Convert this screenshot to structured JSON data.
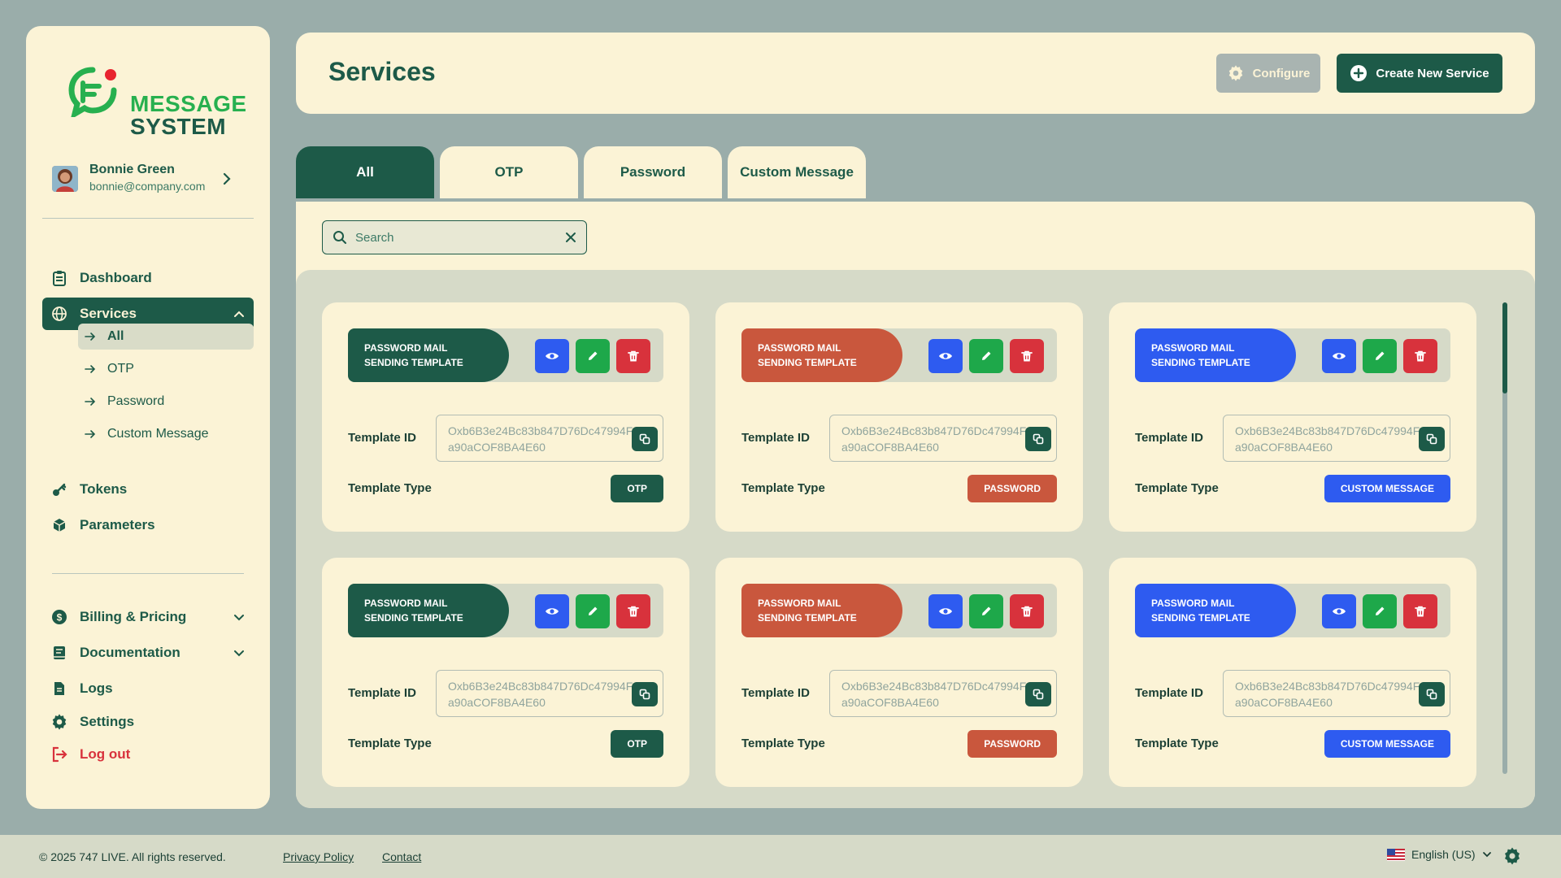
{
  "colors": {
    "primary": "#1d5a48",
    "otp": "#1d5a48",
    "password": "#c9573d",
    "custom": "#2e5bf0",
    "view": "#2e5bf0",
    "edit": "#1ea84a",
    "delete": "#d8323c",
    "cream": "#fbf3d6"
  },
  "brand": {
    "line1": "MESSAGE",
    "line2": "SYSTEM"
  },
  "user": {
    "name": "Bonnie Green",
    "email": "bonnie@company.com"
  },
  "nav": {
    "dashboard": "Dashboard",
    "services": "Services",
    "sub": {
      "all": "All",
      "otp": "OTP",
      "password": "Password",
      "custom": "Custom Message"
    },
    "tokens": "Tokens",
    "parameters": "Parameters",
    "billing": "Billing & Pricing",
    "documentation": "Documentation",
    "logs": "Logs",
    "settings": "Settings",
    "logout": "Log out"
  },
  "header": {
    "title": "Services",
    "configure": "Configure",
    "create": "Create New Service"
  },
  "tabs": [
    "All",
    "OTP",
    "Password",
    "Custom Message"
  ],
  "search": {
    "placeholder": "Search"
  },
  "cards": [
    {
      "title_line1": "PASSWORD MAIL",
      "title_line2": "SENDING TEMPLATE",
      "id_label": "Template ID",
      "template_id": "Oxb6B3e24Bc83b847D76Dc47994Fa90aCOF8BA4E60",
      "type_label": "Template Type",
      "type": "OTP"
    },
    {
      "title_line1": "PASSWORD MAIL",
      "title_line2": "SENDING TEMPLATE",
      "id_label": "Template ID",
      "template_id": "Oxb6B3e24Bc83b847D76Dc47994Fa90aCOF8BA4E60",
      "type_label": "Template Type",
      "type": "PASSWORD"
    },
    {
      "title_line1": "PASSWORD MAIL",
      "title_line2": "SENDING TEMPLATE",
      "id_label": "Template ID",
      "template_id": "Oxb6B3e24Bc83b847D76Dc47994Fa90aCOF8BA4E60",
      "type_label": "Template Type",
      "type": "CUSTOM MESSAGE"
    },
    {
      "title_line1": "PASSWORD MAIL",
      "title_line2": "SENDING TEMPLATE",
      "id_label": "Template ID",
      "template_id": "Oxb6B3e24Bc83b847D76Dc47994Fa90aCOF8BA4E60",
      "type_label": "Template Type",
      "type": "OTP"
    },
    {
      "title_line1": "PASSWORD MAIL",
      "title_line2": "SENDING TEMPLATE",
      "id_label": "Template ID",
      "template_id": "Oxb6B3e24Bc83b847D76Dc47994Fa90aCOF8BA4E60",
      "type_label": "Template Type",
      "type": "PASSWORD"
    },
    {
      "title_line1": "PASSWORD MAIL",
      "title_line2": "SENDING TEMPLATE",
      "id_label": "Template ID",
      "template_id": "Oxb6B3e24Bc83b847D76Dc47994Fa90aCOF8BA4E60",
      "type_label": "Template Type",
      "type": "CUSTOM MESSAGE"
    }
  ],
  "footer": {
    "copyright": "© 2025 747 LIVE. All rights reserved.",
    "privacy": "Privacy Policy",
    "contact": "Contact",
    "language": "English (US)"
  },
  "icons": {
    "logo": "message-bubble-logo",
    "dashboard": "clipboard-icon",
    "services": "globe-icon",
    "tokens": "key-icon",
    "parameters": "cube-icon",
    "billing": "dollar-icon",
    "documentation": "book-icon",
    "logs": "file-icon",
    "settings": "gear-icon",
    "logout": "logout-icon"
  }
}
